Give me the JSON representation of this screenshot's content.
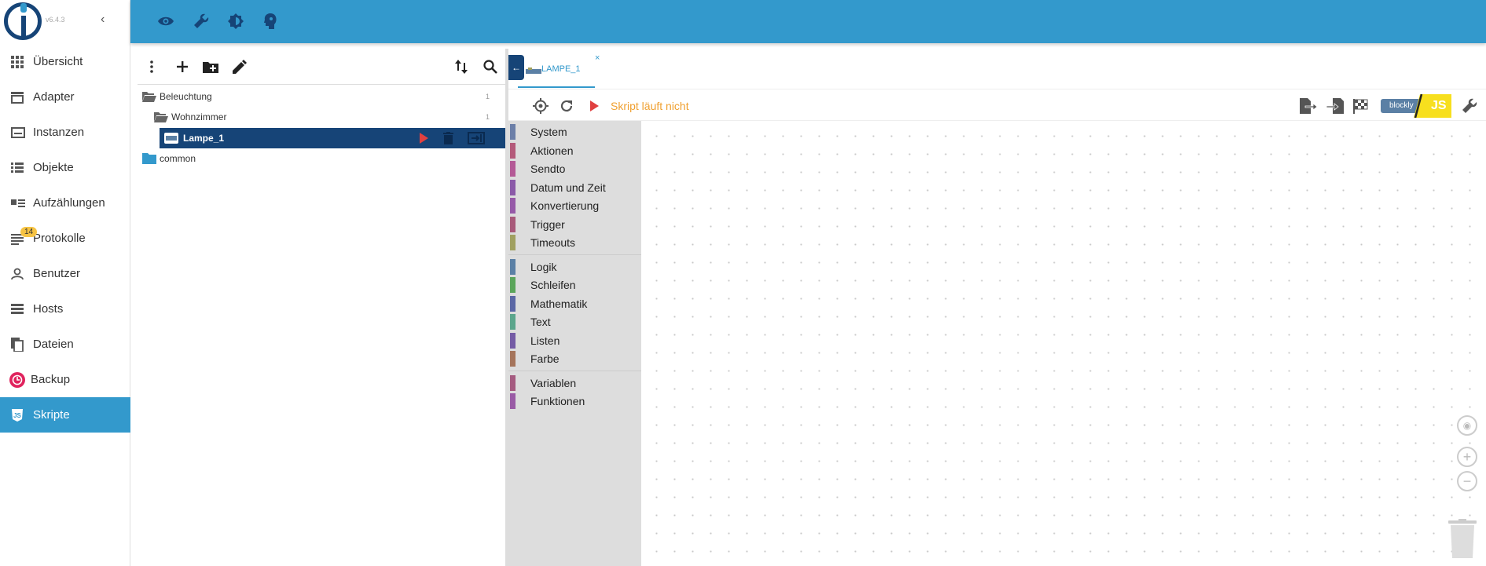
{
  "app": {
    "version": "v6.4.3"
  },
  "sidebar": {
    "items": [
      {
        "label": "Übersicht",
        "icon": "grid-icon"
      },
      {
        "label": "Adapter",
        "icon": "store-icon"
      },
      {
        "label": "Instanzen",
        "icon": "instances-icon"
      },
      {
        "label": "Objekte",
        "icon": "list-icon"
      },
      {
        "label": "Aufzählungen",
        "icon": "enum-icon"
      },
      {
        "label": "Protokolle",
        "icon": "log-icon",
        "badge": "14"
      },
      {
        "label": "Benutzer",
        "icon": "user-icon"
      },
      {
        "label": "Hosts",
        "icon": "hosts-icon"
      },
      {
        "label": "Dateien",
        "icon": "files-icon"
      },
      {
        "label": "Backup",
        "icon": "backup-icon"
      },
      {
        "label": "Skripte",
        "icon": "js-icon",
        "active": true
      }
    ]
  },
  "topbar": {
    "icons": [
      "eye-icon",
      "wrench-icon",
      "brightness-icon",
      "head-icon"
    ]
  },
  "tree": {
    "rows": [
      {
        "label": "Beleuchtung",
        "count": "1",
        "type": "folder-open"
      },
      {
        "label": "Wohnzimmer",
        "count": "1",
        "type": "folder-open"
      },
      {
        "label": "Lampe_1",
        "type": "script",
        "selected": true
      },
      {
        "label": "common",
        "type": "folder"
      }
    ]
  },
  "editor": {
    "tab_label": "LAMPE_1",
    "tab_close": "×",
    "status": "Skript läuft nicht",
    "blockly_label": "blockly",
    "js_label": "JS"
  },
  "toolbox": {
    "groups": [
      [
        {
          "label": "System",
          "color": "#6c7fa8"
        },
        {
          "label": "Aktionen",
          "color": "#b45a7a"
        },
        {
          "label": "Sendto",
          "color": "#b45a96"
        },
        {
          "label": "Datum und Zeit",
          "color": "#8b5aa8"
        },
        {
          "label": "Konvertierung",
          "color": "#965aa8"
        },
        {
          "label": "Trigger",
          "color": "#a85a7a"
        },
        {
          "label": "Timeouts",
          "color": "#a0a060"
        }
      ],
      [
        {
          "label": "Logik",
          "color": "#5b80a5"
        },
        {
          "label": "Schleifen",
          "color": "#5ba55b"
        },
        {
          "label": "Mathematik",
          "color": "#5b67a5"
        },
        {
          "label": "Text",
          "color": "#5ba58c"
        },
        {
          "label": "Listen",
          "color": "#745ba5"
        },
        {
          "label": "Farbe",
          "color": "#a5745b"
        }
      ],
      [
        {
          "label": "Variablen",
          "color": "#a55b80"
        },
        {
          "label": "Funktionen",
          "color": "#995ba5"
        }
      ]
    ]
  },
  "colors": {
    "primary": "#3399cc",
    "dark": "#164477",
    "status": "#f0a030"
  }
}
